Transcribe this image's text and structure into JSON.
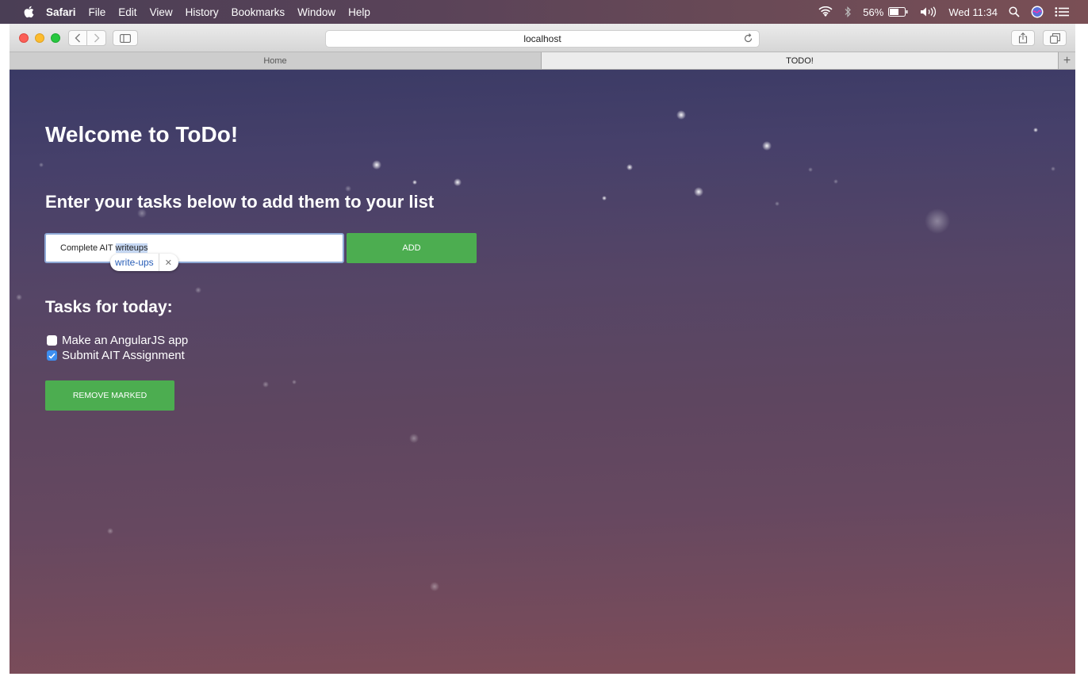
{
  "menubar": {
    "app_name": "Safari",
    "items": [
      "File",
      "Edit",
      "View",
      "History",
      "Bookmarks",
      "Window",
      "Help"
    ],
    "battery": "56%",
    "clock": "Wed 11:34"
  },
  "toolbar": {
    "url": "localhost"
  },
  "tabs": [
    {
      "label": "Home",
      "active": false
    },
    {
      "label": "TODO!",
      "active": true
    }
  ],
  "page": {
    "title": "Welcome to ToDo!",
    "subtitle": "Enter your tasks below to add them to your list",
    "input": {
      "value_prefix": "Complete AIT ",
      "value_selected": "writeups"
    },
    "autocorrect_suggestion": "write-ups",
    "add_label": "ADD",
    "tasks_title": "Tasks for today:",
    "tasks": [
      {
        "label": "Make an AngularJS app",
        "checked": false
      },
      {
        "label": "Submit AIT Assignment",
        "checked": true
      }
    ],
    "remove_label": "REMOVE MARKED"
  },
  "colors": {
    "button_green": "#4cad50",
    "checkbox_blue": "#3d8ef0"
  }
}
